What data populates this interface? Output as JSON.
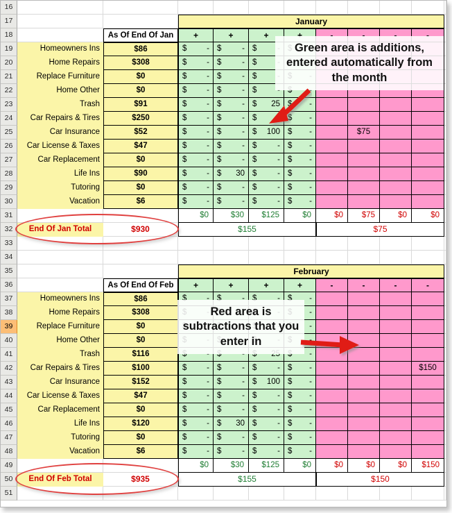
{
  "colors": {
    "green_fill": "#ccf2cc",
    "pink_fill": "#ff99cc",
    "yellow_fill": "#fbf5a8",
    "annotation_red": "#e0403f",
    "total_green_text": "#1e7d32",
    "total_red_text": "#d00000",
    "active_row_header": "#fcbe76"
  },
  "row_numbers": [
    "16",
    "17",
    "18",
    "19",
    "20",
    "21",
    "22",
    "23",
    "24",
    "25",
    "26",
    "27",
    "28",
    "29",
    "30",
    "31",
    "32",
    "33",
    "34",
    "35",
    "36",
    "37",
    "38",
    "39",
    "40",
    "41",
    "42",
    "43",
    "44",
    "45",
    "46",
    "47",
    "48",
    "49",
    "50",
    "51"
  ],
  "active_row_number": "39",
  "annotations": {
    "callout_green": "Green area is additions, entered automatically from the month",
    "callout_red": "Red area is subtractions that you enter in",
    "arrow_green_name": "red-arrow-pointing-to-green-area",
    "arrow_red_name": "red-arrow-pointing-to-red-area",
    "ellipse_jan_name": "red-ellipse-around-end-of-jan-total",
    "ellipse_feb_name": "red-ellipse-around-end-of-feb-total"
  },
  "january": {
    "banner": "January",
    "as_of_header": "As Of End Of Jan",
    "plus_signs": [
      "+",
      "+",
      "+",
      "+"
    ],
    "minus_signs": [
      "-",
      "-",
      "-",
      "-"
    ],
    "rows": [
      {
        "row": "19",
        "label": "Homeowners Ins",
        "value": "$86",
        "green": [
          {
            "sym": "$",
            "amt": "-"
          },
          {
            "sym": "$",
            "amt": "-"
          },
          {
            "sym": "$",
            "amt": "-"
          },
          {
            "sym": "$",
            "amt": "-"
          }
        ],
        "pink": [
          "",
          "",
          "",
          ""
        ]
      },
      {
        "row": "20",
        "label": "Home Repairs",
        "value": "$308",
        "green": [
          {
            "sym": "$",
            "amt": "-"
          },
          {
            "sym": "$",
            "amt": "-"
          },
          {
            "sym": "$",
            "amt": "-"
          },
          {
            "sym": "$",
            "amt": "-"
          }
        ],
        "pink": [
          "",
          "",
          "",
          ""
        ]
      },
      {
        "row": "21",
        "label": "Replace Furniture",
        "value": "$0",
        "green": [
          {
            "sym": "$",
            "amt": "-"
          },
          {
            "sym": "$",
            "amt": "-"
          },
          {
            "sym": "$",
            "amt": "-"
          },
          {
            "sym": "$",
            "amt": "-"
          }
        ],
        "pink": [
          "",
          "",
          "",
          ""
        ]
      },
      {
        "row": "22",
        "label": "Home Other",
        "value": "$0",
        "green": [
          {
            "sym": "$",
            "amt": "-"
          },
          {
            "sym": "$",
            "amt": "-"
          },
          {
            "sym": "$",
            "amt": "-"
          },
          {
            "sym": "$",
            "amt": "-"
          }
        ],
        "pink": [
          "",
          "",
          "",
          ""
        ]
      },
      {
        "row": "23",
        "label": "Trash",
        "value": "$91",
        "green": [
          {
            "sym": "$",
            "amt": "-"
          },
          {
            "sym": "$",
            "amt": "-"
          },
          {
            "sym": "$",
            "amt": "25"
          },
          {
            "sym": "$",
            "amt": "-"
          }
        ],
        "pink": [
          "",
          "",
          "",
          ""
        ]
      },
      {
        "row": "24",
        "label": "Car Repairs & Tires",
        "value": "$250",
        "green": [
          {
            "sym": "$",
            "amt": "-"
          },
          {
            "sym": "$",
            "amt": "-"
          },
          {
            "sym": "$",
            "amt": "-"
          },
          {
            "sym": "$",
            "amt": "-"
          }
        ],
        "pink": [
          "",
          "",
          "",
          ""
        ]
      },
      {
        "row": "25",
        "label": "Car Insurance",
        "value": "$52",
        "green": [
          {
            "sym": "$",
            "amt": "-"
          },
          {
            "sym": "$",
            "amt": "-"
          },
          {
            "sym": "$",
            "amt": "100"
          },
          {
            "sym": "$",
            "amt": "-"
          }
        ],
        "pink": [
          "",
          "$75",
          "",
          ""
        ]
      },
      {
        "row": "26",
        "label": "Car License & Taxes",
        "value": "$47",
        "green": [
          {
            "sym": "$",
            "amt": "-"
          },
          {
            "sym": "$",
            "amt": "-"
          },
          {
            "sym": "$",
            "amt": "-"
          },
          {
            "sym": "$",
            "amt": "-"
          }
        ],
        "pink": [
          "",
          "",
          "",
          ""
        ]
      },
      {
        "row": "27",
        "label": "Car Replacement",
        "value": "$0",
        "green": [
          {
            "sym": "$",
            "amt": "-"
          },
          {
            "sym": "$",
            "amt": "-"
          },
          {
            "sym": "$",
            "amt": "-"
          },
          {
            "sym": "$",
            "amt": "-"
          }
        ],
        "pink": [
          "",
          "",
          "",
          ""
        ]
      },
      {
        "row": "28",
        "label": "Life Ins",
        "value": "$90",
        "green": [
          {
            "sym": "$",
            "amt": "-"
          },
          {
            "sym": "$",
            "amt": "30"
          },
          {
            "sym": "$",
            "amt": "-"
          },
          {
            "sym": "$",
            "amt": "-"
          }
        ],
        "pink": [
          "",
          "",
          "",
          ""
        ]
      },
      {
        "row": "29",
        "label": "Tutoring",
        "value": "$0",
        "green": [
          {
            "sym": "$",
            "amt": "-"
          },
          {
            "sym": "$",
            "amt": "-"
          },
          {
            "sym": "$",
            "amt": "-"
          },
          {
            "sym": "$",
            "amt": "-"
          }
        ],
        "pink": [
          "",
          "",
          "",
          ""
        ]
      },
      {
        "row": "30",
        "label": "Vacation",
        "value": "$6",
        "green": [
          {
            "sym": "$",
            "amt": "-"
          },
          {
            "sym": "$",
            "amt": "-"
          },
          {
            "sym": "$",
            "amt": "-"
          },
          {
            "sym": "$",
            "amt": "-"
          }
        ],
        "pink": [
          "",
          "",
          "",
          ""
        ]
      }
    ],
    "column_totals_green": [
      "$0",
      "$30",
      "$125",
      "$0"
    ],
    "column_totals_pink": [
      "$0",
      "$75",
      "$0",
      "$0"
    ],
    "end_label": "End Of Jan Total",
    "end_value": "$930",
    "grand_green": "$155",
    "grand_pink": "$75"
  },
  "february": {
    "banner": "February",
    "as_of_header": "As Of End Of Feb",
    "plus_signs": [
      "+",
      "+",
      "+",
      "+"
    ],
    "minus_signs": [
      "-",
      "-",
      "-",
      "-"
    ],
    "rows": [
      {
        "row": "37",
        "label": "Homeowners Ins",
        "value": "$86",
        "green": [
          {
            "sym": "$",
            "amt": "-"
          },
          {
            "sym": "$",
            "amt": "-"
          },
          {
            "sym": "$",
            "amt": "-"
          },
          {
            "sym": "$",
            "amt": "-"
          }
        ],
        "pink": [
          "",
          "",
          "",
          ""
        ]
      },
      {
        "row": "38",
        "label": "Home Repairs",
        "value": "$308",
        "green": [
          {
            "sym": "$",
            "amt": "-"
          },
          {
            "sym": "$",
            "amt": "-"
          },
          {
            "sym": "$",
            "amt": "-"
          },
          {
            "sym": "$",
            "amt": "-"
          }
        ],
        "pink": [
          "",
          "",
          "",
          ""
        ]
      },
      {
        "row": "39",
        "label": "Replace Furniture",
        "value": "$0",
        "green": [
          {
            "sym": "$",
            "amt": "-"
          },
          {
            "sym": "$",
            "amt": "-"
          },
          {
            "sym": "$",
            "amt": "-"
          },
          {
            "sym": "$",
            "amt": "-"
          }
        ],
        "pink": [
          "",
          "",
          "",
          ""
        ]
      },
      {
        "row": "40",
        "label": "Home Other",
        "value": "$0",
        "green": [
          {
            "sym": "$",
            "amt": "-"
          },
          {
            "sym": "$",
            "amt": "-"
          },
          {
            "sym": "$",
            "amt": "-"
          },
          {
            "sym": "$",
            "amt": "-"
          }
        ],
        "pink": [
          "",
          "",
          "",
          ""
        ]
      },
      {
        "row": "41",
        "label": "Trash",
        "value": "$116",
        "green": [
          {
            "sym": "$",
            "amt": "-"
          },
          {
            "sym": "$",
            "amt": "-"
          },
          {
            "sym": "$",
            "amt": "25"
          },
          {
            "sym": "$",
            "amt": "-"
          }
        ],
        "pink": [
          "",
          "",
          "",
          ""
        ]
      },
      {
        "row": "42",
        "label": "Car Repairs & Tires",
        "value": "$100",
        "green": [
          {
            "sym": "$",
            "amt": "-"
          },
          {
            "sym": "$",
            "amt": "-"
          },
          {
            "sym": "$",
            "amt": "-"
          },
          {
            "sym": "$",
            "amt": "-"
          }
        ],
        "pink": [
          "",
          "",
          "",
          "$150"
        ]
      },
      {
        "row": "43",
        "label": "Car Insurance",
        "value": "$152",
        "green": [
          {
            "sym": "$",
            "amt": "-"
          },
          {
            "sym": "$",
            "amt": "-"
          },
          {
            "sym": "$",
            "amt": "100"
          },
          {
            "sym": "$",
            "amt": "-"
          }
        ],
        "pink": [
          "",
          "",
          "",
          ""
        ]
      },
      {
        "row": "44",
        "label": "Car License & Taxes",
        "value": "$47",
        "green": [
          {
            "sym": "$",
            "amt": "-"
          },
          {
            "sym": "$",
            "amt": "-"
          },
          {
            "sym": "$",
            "amt": "-"
          },
          {
            "sym": "$",
            "amt": "-"
          }
        ],
        "pink": [
          "",
          "",
          "",
          ""
        ]
      },
      {
        "row": "45",
        "label": "Car Replacement",
        "value": "$0",
        "green": [
          {
            "sym": "$",
            "amt": "-"
          },
          {
            "sym": "$",
            "amt": "-"
          },
          {
            "sym": "$",
            "amt": "-"
          },
          {
            "sym": "$",
            "amt": "-"
          }
        ],
        "pink": [
          "",
          "",
          "",
          ""
        ]
      },
      {
        "row": "46",
        "label": "Life Ins",
        "value": "$120",
        "green": [
          {
            "sym": "$",
            "amt": "-"
          },
          {
            "sym": "$",
            "amt": "30"
          },
          {
            "sym": "$",
            "amt": "-"
          },
          {
            "sym": "$",
            "amt": "-"
          }
        ],
        "pink": [
          "",
          "",
          "",
          ""
        ]
      },
      {
        "row": "47",
        "label": "Tutoring",
        "value": "$0",
        "green": [
          {
            "sym": "$",
            "amt": "-"
          },
          {
            "sym": "$",
            "amt": "-"
          },
          {
            "sym": "$",
            "amt": "-"
          },
          {
            "sym": "$",
            "amt": "-"
          }
        ],
        "pink": [
          "",
          "",
          "",
          ""
        ]
      },
      {
        "row": "48",
        "label": "Vacation",
        "value": "$6",
        "green": [
          {
            "sym": "$",
            "amt": "-"
          },
          {
            "sym": "$",
            "amt": "-"
          },
          {
            "sym": "$",
            "amt": "-"
          },
          {
            "sym": "$",
            "amt": "-"
          }
        ],
        "pink": [
          "",
          "",
          "",
          ""
        ]
      }
    ],
    "column_totals_green": [
      "$0",
      "$30",
      "$125",
      "$0"
    ],
    "column_totals_pink": [
      "$0",
      "$0",
      "$0",
      "$150"
    ],
    "end_label": "End Of Feb Total",
    "end_value": "$935",
    "grand_green": "$155",
    "grand_pink": "$150"
  }
}
